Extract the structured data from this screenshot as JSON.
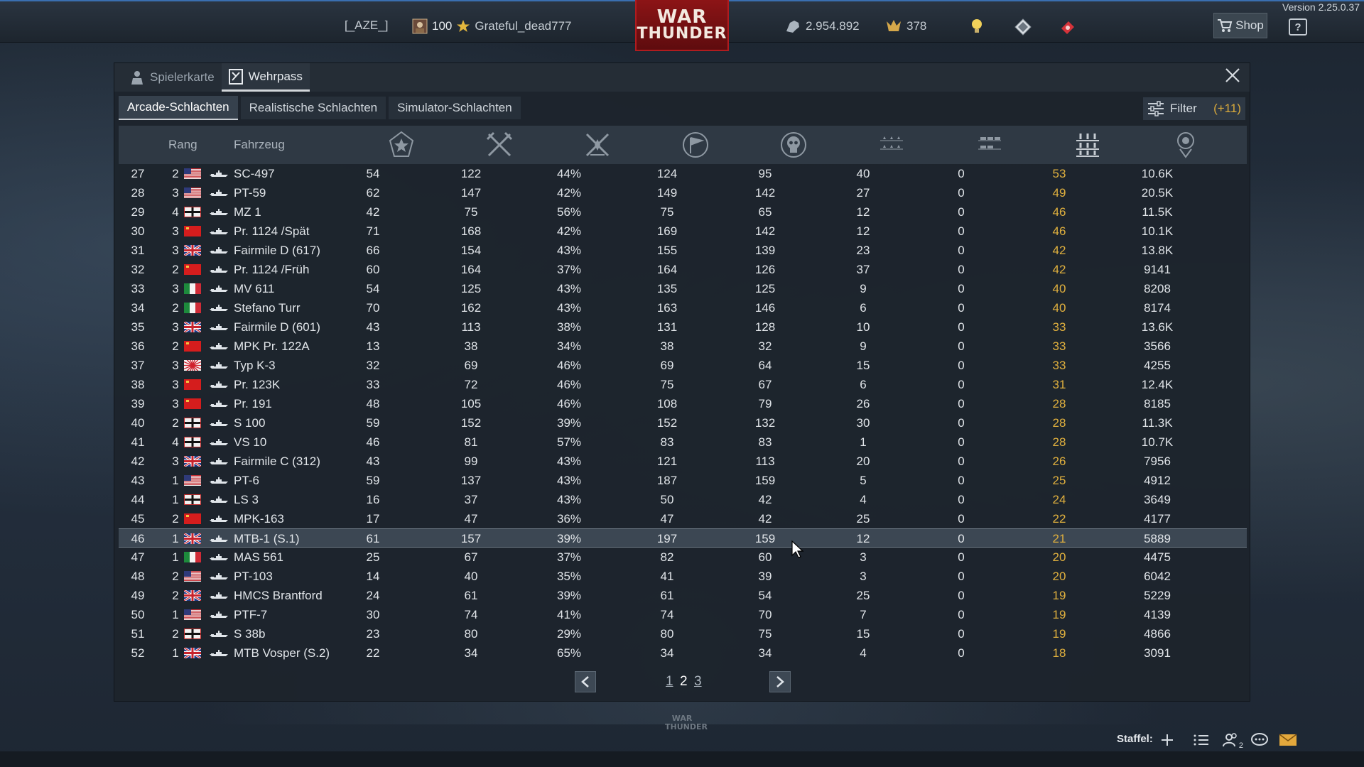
{
  "version": "Version 2.25.0.37",
  "topbar": {
    "squadron_tag": "[_AZE_]",
    "level": "100",
    "username": "Grateful_dead777",
    "logo_line1": "WAR",
    "logo_line2": "THUNDER",
    "silver_lions": "2.954.892",
    "golden_eagles": "378",
    "shop_label": "Shop",
    "help_label": "?"
  },
  "panel": {
    "tabs": [
      {
        "label": "Spielerkarte",
        "icon": "player-card-icon"
      },
      {
        "label": "Wehrpass",
        "icon": "service-record-icon"
      }
    ],
    "modes": [
      "Arcade-Schlachten",
      "Realistische Schlachten",
      "Simulator-Schlachten"
    ],
    "filter_label": "Filter",
    "filter_count": "(+11)"
  },
  "table": {
    "headers": {
      "rank": "Rang",
      "vehicle": "Fahrzeug"
    },
    "column_icons": [
      "battles-icon",
      "respawns-icon",
      "victories-percent-icon",
      "completed-missions-icon",
      "deaths-icon",
      "kills-air-icon",
      "kills-ground-icon",
      "kills-naval-icon",
      "activity-icon"
    ],
    "rows": [
      {
        "n": "27",
        "rank": "2",
        "nation": "usa",
        "name": "SC-497",
        "v": [
          "54",
          "122",
          "44%",
          "124",
          "95",
          "40",
          "0",
          "53",
          "10.6K"
        ]
      },
      {
        "n": "28",
        "rank": "3",
        "nation": "usa",
        "name": "PT-59",
        "v": [
          "62",
          "147",
          "42%",
          "149",
          "142",
          "27",
          "0",
          "49",
          "20.5K"
        ]
      },
      {
        "n": "29",
        "rank": "4",
        "nation": "germany",
        "name": "MZ 1",
        "v": [
          "42",
          "75",
          "56%",
          "75",
          "65",
          "12",
          "0",
          "46",
          "11.5K"
        ]
      },
      {
        "n": "30",
        "rank": "3",
        "nation": "ussr",
        "name": "Pr. 1124 /Spät",
        "v": [
          "71",
          "168",
          "42%",
          "169",
          "142",
          "12",
          "0",
          "46",
          "10.1K"
        ]
      },
      {
        "n": "31",
        "rank": "3",
        "nation": "uk",
        "name": "Fairmile D (617)",
        "v": [
          "66",
          "154",
          "43%",
          "155",
          "139",
          "23",
          "0",
          "42",
          "13.8K"
        ]
      },
      {
        "n": "32",
        "rank": "2",
        "nation": "ussr",
        "name": "Pr. 1124 /Früh",
        "v": [
          "60",
          "164",
          "37%",
          "164",
          "126",
          "37",
          "0",
          "42",
          "9141"
        ]
      },
      {
        "n": "33",
        "rank": "3",
        "nation": "italy",
        "name": "MV 611",
        "v": [
          "54",
          "125",
          "43%",
          "135",
          "125",
          "9",
          "0",
          "40",
          "8208"
        ]
      },
      {
        "n": "34",
        "rank": "2",
        "nation": "italy",
        "name": "Stefano Turr",
        "v": [
          "70",
          "162",
          "43%",
          "163",
          "146",
          "6",
          "0",
          "40",
          "8174"
        ]
      },
      {
        "n": "35",
        "rank": "3",
        "nation": "uk",
        "name": "Fairmile D (601)",
        "v": [
          "43",
          "113",
          "38%",
          "131",
          "128",
          "10",
          "0",
          "33",
          "13.6K"
        ]
      },
      {
        "n": "36",
        "rank": "2",
        "nation": "ussr",
        "name": "MPK Pr. 122A",
        "v": [
          "13",
          "38",
          "34%",
          "38",
          "32",
          "9",
          "0",
          "33",
          "3566"
        ]
      },
      {
        "n": "37",
        "rank": "3",
        "nation": "japan",
        "name": "Typ K-3",
        "v": [
          "32",
          "69",
          "46%",
          "69",
          "64",
          "15",
          "0",
          "33",
          "4255"
        ]
      },
      {
        "n": "38",
        "rank": "3",
        "nation": "ussr",
        "name": "Pr. 123K",
        "v": [
          "33",
          "72",
          "46%",
          "75",
          "67",
          "6",
          "0",
          "31",
          "12.4K"
        ]
      },
      {
        "n": "39",
        "rank": "3",
        "nation": "ussr",
        "name": "Pr. 191",
        "v": [
          "48",
          "105",
          "46%",
          "108",
          "79",
          "26",
          "0",
          "28",
          "8185"
        ]
      },
      {
        "n": "40",
        "rank": "2",
        "nation": "germany",
        "name": "S 100",
        "v": [
          "59",
          "152",
          "39%",
          "152",
          "132",
          "30",
          "0",
          "28",
          "11.3K"
        ]
      },
      {
        "n": "41",
        "rank": "4",
        "nation": "germany",
        "name": "VS 10",
        "v": [
          "46",
          "81",
          "57%",
          "83",
          "83",
          "1",
          "0",
          "28",
          "10.7K"
        ]
      },
      {
        "n": "42",
        "rank": "3",
        "nation": "uk",
        "name": "Fairmile C (312)",
        "v": [
          "43",
          "99",
          "43%",
          "121",
          "113",
          "20",
          "0",
          "26",
          "7956"
        ]
      },
      {
        "n": "43",
        "rank": "1",
        "nation": "usa",
        "name": "PT-6",
        "v": [
          "59",
          "137",
          "43%",
          "187",
          "159",
          "5",
          "0",
          "25",
          "4912"
        ]
      },
      {
        "n": "44",
        "rank": "1",
        "nation": "germany",
        "name": "LS 3",
        "v": [
          "16",
          "37",
          "43%",
          "50",
          "42",
          "4",
          "0",
          "24",
          "3649"
        ]
      },
      {
        "n": "45",
        "rank": "2",
        "nation": "ussr",
        "name": "MPK-163",
        "v": [
          "17",
          "47",
          "36%",
          "47",
          "42",
          "25",
          "0",
          "22",
          "4177"
        ]
      },
      {
        "n": "46",
        "rank": "1",
        "nation": "uk",
        "name": "MTB-1 (S.1)",
        "v": [
          "61",
          "157",
          "39%",
          "197",
          "159",
          "12",
          "0",
          "21",
          "5889"
        ],
        "highlight": true
      },
      {
        "n": "47",
        "rank": "1",
        "nation": "italy",
        "name": "MAS 561",
        "v": [
          "25",
          "67",
          "37%",
          "82",
          "60",
          "3",
          "0",
          "20",
          "4475"
        ]
      },
      {
        "n": "48",
        "rank": "2",
        "nation": "usa",
        "name": "PT-103",
        "v": [
          "14",
          "40",
          "35%",
          "41",
          "39",
          "3",
          "0",
          "20",
          "6042"
        ]
      },
      {
        "n": "49",
        "rank": "2",
        "nation": "uk",
        "name": "HMCS Brantford",
        "v": [
          "24",
          "61",
          "39%",
          "61",
          "54",
          "25",
          "0",
          "19",
          "5229"
        ]
      },
      {
        "n": "50",
        "rank": "1",
        "nation": "usa",
        "name": "PTF-7",
        "v": [
          "30",
          "74",
          "41%",
          "74",
          "70",
          "7",
          "0",
          "19",
          "4139"
        ]
      },
      {
        "n": "51",
        "rank": "2",
        "nation": "germany",
        "name": "S 38b",
        "v": [
          "23",
          "80",
          "29%",
          "80",
          "75",
          "15",
          "0",
          "19",
          "4866"
        ]
      },
      {
        "n": "52",
        "rank": "1",
        "nation": "uk",
        "name": "MTB Vosper (S.2)",
        "v": [
          "22",
          "34",
          "65%",
          "34",
          "34",
          "4",
          "0",
          "18",
          "3091"
        ]
      }
    ]
  },
  "pager": {
    "pages": [
      "1",
      "2",
      "3"
    ],
    "current": "2",
    "prev": "‹",
    "next": "›"
  },
  "bottom": {
    "squad_label": "Staffel:",
    "logo_line1": "WAR",
    "logo_line2": "THUNDER",
    "friends_badge": "2"
  },
  "colors": {
    "accent_gold": "#e0b03e",
    "highlight_row": "#3c4753"
  }
}
